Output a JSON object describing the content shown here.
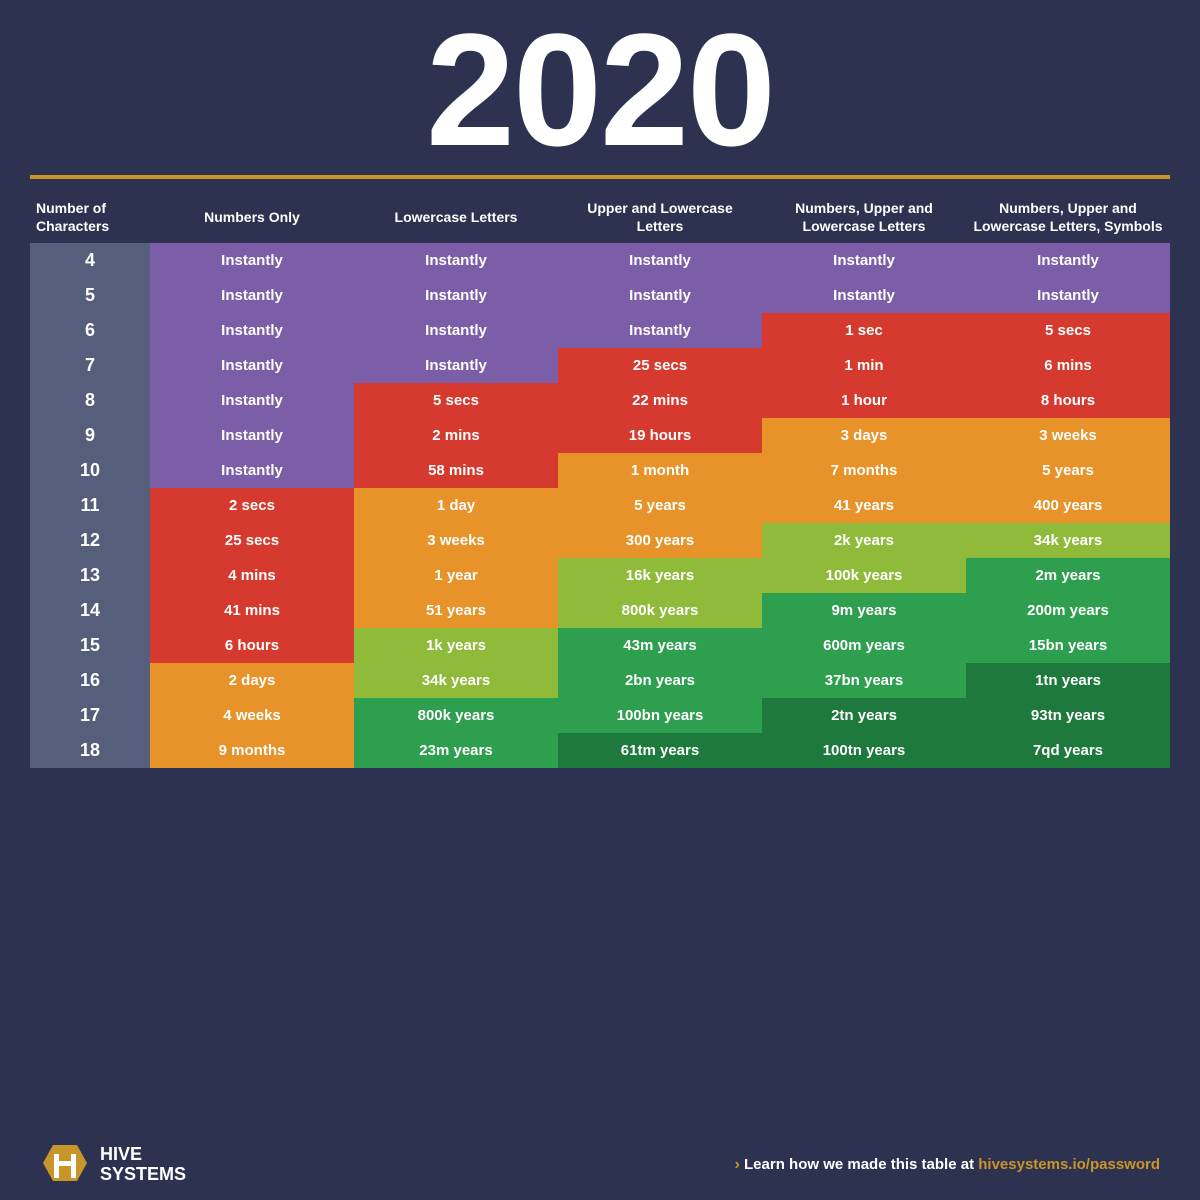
{
  "title": "2020",
  "gold_line": true,
  "table": {
    "headers": [
      "Number of Characters",
      "Numbers Only",
      "Lowercase Letters",
      "Upper and Lowercase Letters",
      "Numbers, Upper and Lowercase Letters",
      "Numbers, Upper and Lowercase Letters, Symbols"
    ],
    "rows": [
      {
        "chars": "4",
        "c1": "Instantly",
        "c2": "Instantly",
        "c3": "Instantly",
        "c4": "Instantly",
        "c5": "Instantly",
        "col1": "purple",
        "col2": "purple",
        "col3": "purple",
        "col4": "purple",
        "col5": "purple"
      },
      {
        "chars": "5",
        "c1": "Instantly",
        "c2": "Instantly",
        "c3": "Instantly",
        "c4": "Instantly",
        "c5": "Instantly",
        "col1": "purple",
        "col2": "purple",
        "col3": "purple",
        "col4": "purple",
        "col5": "purple"
      },
      {
        "chars": "6",
        "c1": "Instantly",
        "c2": "Instantly",
        "c3": "Instantly",
        "c4": "1 sec",
        "c5": "5 secs",
        "col1": "purple",
        "col2": "purple",
        "col3": "purple",
        "col4": "red",
        "col5": "red"
      },
      {
        "chars": "7",
        "c1": "Instantly",
        "c2": "Instantly",
        "c3": "25 secs",
        "c4": "1 min",
        "c5": "6 mins",
        "col1": "purple",
        "col2": "purple",
        "col3": "red",
        "col4": "red",
        "col5": "red"
      },
      {
        "chars": "8",
        "c1": "Instantly",
        "c2": "5 secs",
        "c3": "22 mins",
        "c4": "1 hour",
        "c5": "8 hours",
        "col1": "purple",
        "col2": "red",
        "col3": "red",
        "col4": "red",
        "col5": "red"
      },
      {
        "chars": "9",
        "c1": "Instantly",
        "c2": "2 mins",
        "c3": "19 hours",
        "c4": "3 days",
        "c5": "3 weeks",
        "col1": "purple",
        "col2": "red",
        "col3": "red",
        "col4": "orange",
        "col5": "orange"
      },
      {
        "chars": "10",
        "c1": "Instantly",
        "c2": "58 mins",
        "c3": "1 month",
        "c4": "7 months",
        "c5": "5 years",
        "col1": "purple",
        "col2": "red",
        "col3": "orange",
        "col4": "orange",
        "col5": "orange"
      },
      {
        "chars": "11",
        "c1": "2 secs",
        "c2": "1 day",
        "c3": "5 years",
        "c4": "41 years",
        "c5": "400 years",
        "col1": "red",
        "col2": "orange",
        "col3": "orange",
        "col4": "orange",
        "col5": "orange"
      },
      {
        "chars": "12",
        "c1": "25 secs",
        "c2": "3 weeks",
        "c3": "300 years",
        "c4": "2k years",
        "c5": "34k years",
        "col1": "red",
        "col2": "orange",
        "col3": "orange",
        "col4": "yellow-green",
        "col5": "yellow-green"
      },
      {
        "chars": "13",
        "c1": "4 mins",
        "c2": "1 year",
        "c3": "16k years",
        "c4": "100k years",
        "c5": "2m years",
        "col1": "red",
        "col2": "orange",
        "col3": "yellow-green",
        "col4": "yellow-green",
        "col5": "green"
      },
      {
        "chars": "14",
        "c1": "41 mins",
        "c2": "51 years",
        "c3": "800k years",
        "c4": "9m years",
        "c5": "200m years",
        "col1": "red",
        "col2": "orange",
        "col3": "yellow-green",
        "col4": "green",
        "col5": "green"
      },
      {
        "chars": "15",
        "c1": "6 hours",
        "c2": "1k years",
        "c3": "43m years",
        "c4": "600m years",
        "c5": "15bn years",
        "col1": "red",
        "col2": "yellow-green",
        "col3": "green",
        "col4": "green",
        "col5": "green"
      },
      {
        "chars": "16",
        "c1": "2 days",
        "c2": "34k years",
        "c3": "2bn years",
        "c4": "37bn years",
        "c5": "1tn years",
        "col1": "orange",
        "col2": "yellow-green",
        "col3": "green",
        "col4": "green",
        "col5": "dark-green"
      },
      {
        "chars": "17",
        "c1": "4 weeks",
        "c2": "800k years",
        "c3": "100bn years",
        "c4": "2tn years",
        "c5": "93tn years",
        "col1": "orange",
        "col2": "green",
        "col3": "green",
        "col4": "dark-green",
        "col5": "dark-green"
      },
      {
        "chars": "18",
        "c1": "9 months",
        "c2": "23m years",
        "c3": "61tm years",
        "c4": "100tn years",
        "c5": "7qd years",
        "col1": "orange",
        "col2": "green",
        "col3": "dark-green",
        "col4": "dark-green",
        "col5": "dark-green"
      }
    ]
  },
  "footer": {
    "logo_line1": "HIVE",
    "logo_line2": "SYSTEMS",
    "link_text": "› Learn how we made this table at hivesystems.io/password"
  }
}
